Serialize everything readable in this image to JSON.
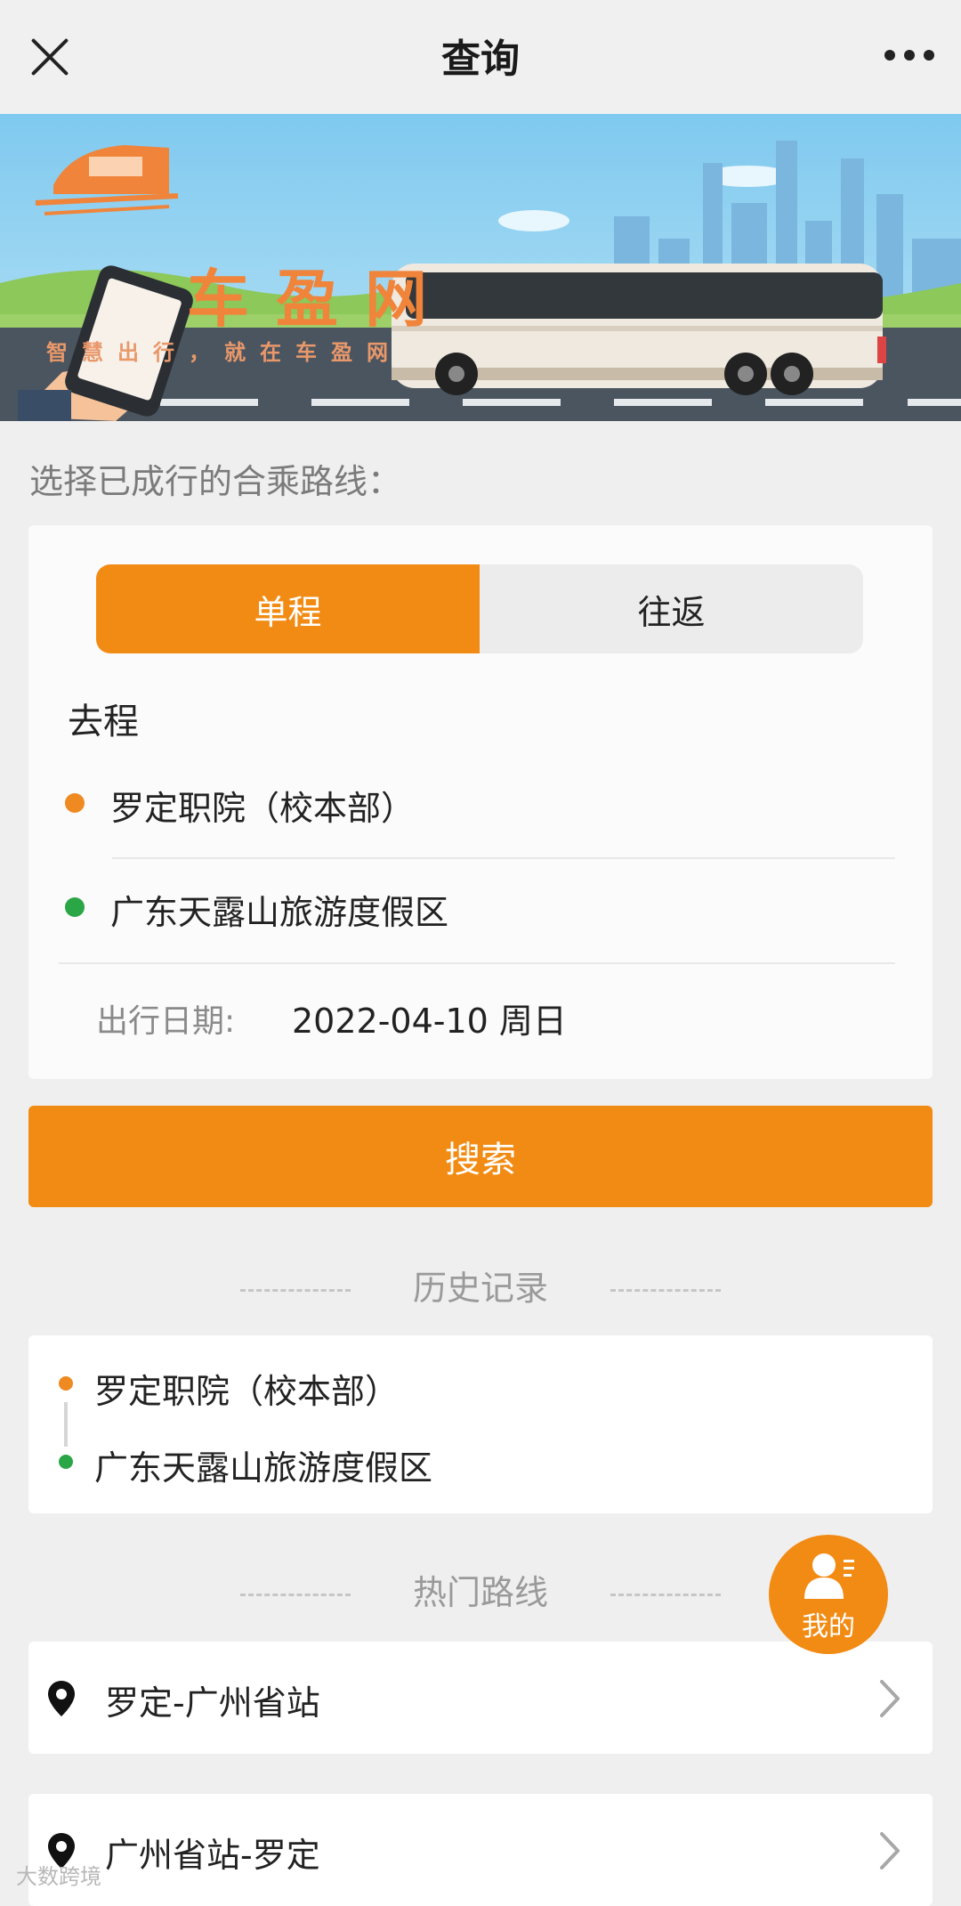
{
  "header": {
    "title": "查询"
  },
  "banner": {
    "brand_name": "车盈网",
    "slogan": "智慧出行，就在车盈网"
  },
  "section_hint": "选择已成行的合乘路线：",
  "trip_type": {
    "tabs": [
      "单程",
      "往返"
    ],
    "selected": "单程"
  },
  "outbound": {
    "label": "去程",
    "from": "罗定职院（校本部）",
    "to": "广东天露山旅游度假区",
    "date_label": "出行日期:",
    "date_value": "2022-04-10 周日"
  },
  "search_button": "搜索",
  "history": {
    "title": "历史记录",
    "items": [
      {
        "from": "罗定职院（校本部）",
        "to": "广东天露山旅游度假区"
      }
    ]
  },
  "hot_routes": {
    "title": "热门路线",
    "items": [
      {
        "label": "罗定-广州省站"
      },
      {
        "label": "广州省站-罗定"
      }
    ]
  },
  "fab": {
    "label": "我的"
  },
  "watermark": "大数跨境",
  "colors": {
    "accent": "#f28b14",
    "from_dot": "#ef8a22",
    "to_dot": "#2ba646"
  }
}
